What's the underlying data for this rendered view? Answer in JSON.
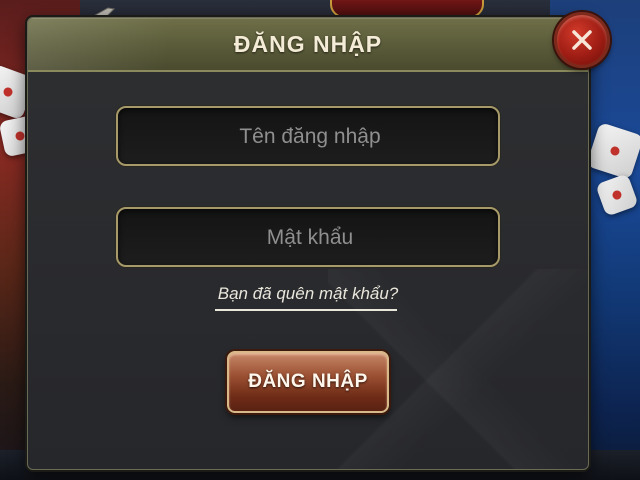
{
  "dialog": {
    "title": "ĐĂNG NHẬP",
    "close_icon": "close-icon",
    "username": {
      "value": "",
      "placeholder": "Tên đăng nhập"
    },
    "password": {
      "value": "",
      "placeholder": "Mật khẩu"
    },
    "forgot_password_link": "Bạn đã quên mật khẩu?",
    "login_button_label": "ĐĂNG NHẬP"
  },
  "colors": {
    "header": "#5d5e3b",
    "panel": "#2b2c2f",
    "field_border": "#a69a6a",
    "close_button": "#9e1d14",
    "login_button": "#9a4f31",
    "title_text": "#f4ecd6"
  }
}
